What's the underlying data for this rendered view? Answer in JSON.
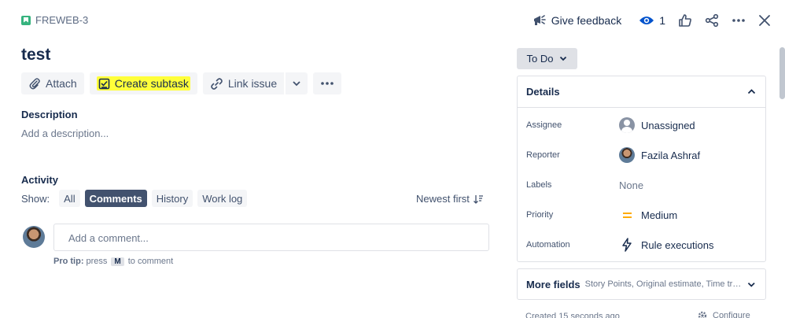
{
  "issue_key": "FREWEB-3",
  "top_bar": {
    "feedback_label": "Give feedback",
    "watchers_count": "1"
  },
  "title": "test",
  "toolbar": {
    "attach_label": "Attach",
    "create_subtask_label": "Create subtask",
    "link_issue_label": "Link issue"
  },
  "description": {
    "heading": "Description",
    "placeholder": "Add a description..."
  },
  "activity": {
    "heading": "Activity",
    "show_label": "Show:",
    "filters": [
      "All",
      "Comments",
      "History",
      "Work log"
    ],
    "active_filter": "Comments",
    "sort_label": "Newest first",
    "comment_placeholder": "Add a comment...",
    "pro_tip_bold": "Pro tip:",
    "pro_tip_press": "press",
    "pro_tip_key": "M",
    "pro_tip_rest": "to comment"
  },
  "status": {
    "label": "To Do"
  },
  "details": {
    "heading": "Details",
    "fields": [
      {
        "label": "Assignee",
        "value": "Unassigned",
        "icon": "unassigned-avatar-icon"
      },
      {
        "label": "Reporter",
        "value": "Fazila Ashraf",
        "icon": "user-avatar"
      },
      {
        "label": "Labels",
        "value": "None",
        "icon": ""
      },
      {
        "label": "Priority",
        "value": "Medium",
        "icon": "priority-medium-icon"
      },
      {
        "label": "Automation",
        "value": "Rule executions",
        "icon": "lightning-icon"
      }
    ]
  },
  "more_fields": {
    "heading": "More fields",
    "summary": "Story Points, Original estimate, Time tracking"
  },
  "footer": {
    "created": "Created 15 seconds ago",
    "configure": "Configure"
  },
  "colors": {
    "highlight": "#ffff3a",
    "priority_medium": "#ffab00",
    "issue_type": "#36b37e",
    "watch_blue": "#0052cc"
  }
}
